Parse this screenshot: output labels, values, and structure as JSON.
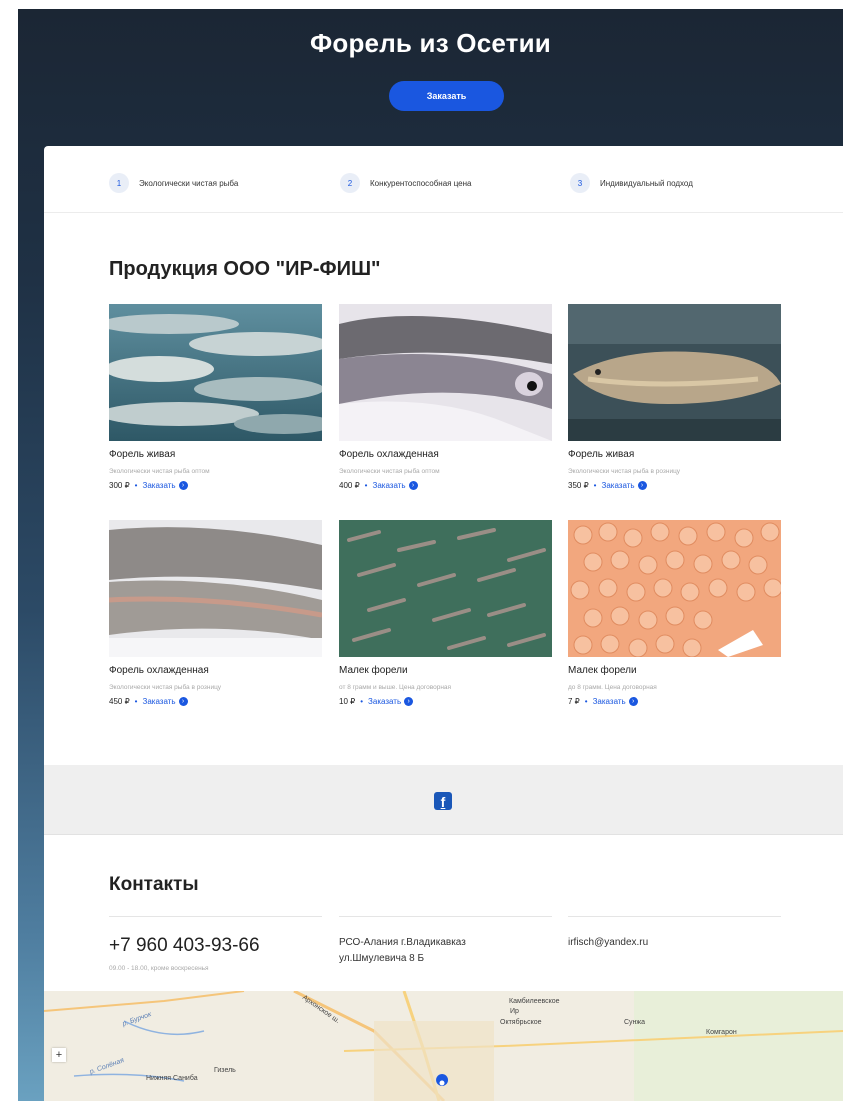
{
  "hero": {
    "title": "Форель из Осетии",
    "order_button": "Заказать"
  },
  "features": [
    {
      "num": "1",
      "label": "Экологически чистая рыба"
    },
    {
      "num": "2",
      "label": "Конкурентоспособная цена"
    },
    {
      "num": "3",
      "label": "Индивидуальный подход"
    }
  ],
  "products_section": {
    "title": "Продукция ООО \"ИР-ФИШ\""
  },
  "products": [
    {
      "name": "Форель живая",
      "desc": "Экологически чистая рыба оптом",
      "price": "300 ₽",
      "order": "Заказать"
    },
    {
      "name": "Форель охлажденная",
      "desc": "Экологически чистая рыба оптом",
      "price": "400 ₽",
      "order": "Заказать"
    },
    {
      "name": "Форель живая",
      "desc": "Экологически чистая рыба в розницу",
      "price": "350 ₽",
      "order": "Заказать"
    },
    {
      "name": "Форель охлажденная",
      "desc": "Экологически чистая рыба в розницу",
      "price": "450 ₽",
      "order": "Заказать"
    },
    {
      "name": "Малек форели",
      "desc": "от 8 грамм и выше. Цена договорная",
      "price": "10 ₽",
      "order": "Заказать"
    },
    {
      "name": "Малек форели",
      "desc": "до 8 грамм. Цена договорная",
      "price": "7 ₽",
      "order": "Заказать"
    }
  ],
  "social": {
    "facebook_icon": "facebook-icon",
    "facebook_glyph": "f"
  },
  "contacts": {
    "title": "Контакты",
    "phone": "+7 960 403-93-66",
    "hours": "09.00 - 18.00, кроме воскресенья",
    "address_line1": "РСО-Алания г.Владикавказ",
    "address_line2": "ул.Шмулевича 8 Б",
    "email": "irfisch@yandex.ru"
  },
  "map": {
    "zoom_in": "+",
    "labels": {
      "kambileevskoe": "Камбилеевское",
      "ir": "Ир",
      "oktyabrskoe": "Октябрьское",
      "sunzha": "Сунжа",
      "komgaron": "Комгарон",
      "nizhnyaya_sanibá": "Нижняя Саниба",
      "gizel": "Гизель",
      "r_solenaya": "р. Солёная",
      "r_bychok": "р. Бурчок",
      "arkhonskoe_sh": "Архонское ш."
    }
  }
}
